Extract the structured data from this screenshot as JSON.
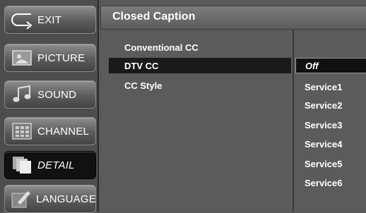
{
  "sidebar": {
    "items": [
      {
        "label": "EXIT"
      },
      {
        "label": "PICTURE"
      },
      {
        "label": "SOUND"
      },
      {
        "label": "CHANNEL"
      },
      {
        "label": "DETAIL"
      },
      {
        "label": "LANGUAGE"
      }
    ]
  },
  "header": {
    "title": "Closed Caption"
  },
  "menu": {
    "items": [
      {
        "label": "Conventional CC"
      },
      {
        "label": "DTV CC"
      },
      {
        "label": "CC Style"
      }
    ]
  },
  "submenu": {
    "items": [
      {
        "label": "Off"
      },
      {
        "label": "Service1"
      },
      {
        "label": "Service2"
      },
      {
        "label": "Service3"
      },
      {
        "label": "Service4"
      },
      {
        "label": "Service5"
      },
      {
        "label": "Service6"
      }
    ]
  },
  "colors": {
    "selected_bg": "#111111",
    "panel_bg": "#5b5b5b",
    "sidebar_bg": "#4d4d4d"
  }
}
